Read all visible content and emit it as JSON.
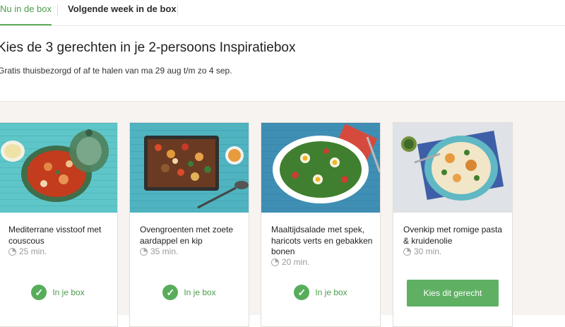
{
  "tabs": [
    {
      "label": "Nu in de box"
    },
    {
      "label": "Volgende week in de box"
    }
  ],
  "headline": "Kies de 3 gerechten in je 2-persoons Inspiratiebox",
  "subline": "Gratis thuisbezorgd of af te halen van ma 29 aug t/m zo 4 sep.",
  "recipes": [
    {
      "title": "Mediterrane visstoof met couscous",
      "time": "25 min.",
      "status": "In je box"
    },
    {
      "title": "Ovengroenten met zoete aardappel en kip",
      "time": "35 min.",
      "status": "In je box"
    },
    {
      "title": "Maaltijdsalade met spek, haricots verts en gebakken bonen",
      "time": "20 min.",
      "status": "In je box"
    },
    {
      "title": "Ovenkip met romige pasta & kruidenolie",
      "time": "30 min.",
      "button": "Kies dit gerecht"
    }
  ],
  "icons": {
    "clock": "clock-icon",
    "check": "checkmark-icon"
  },
  "colors": {
    "accent_green": "#5aae5c",
    "band_bg": "#f6f3f0"
  }
}
